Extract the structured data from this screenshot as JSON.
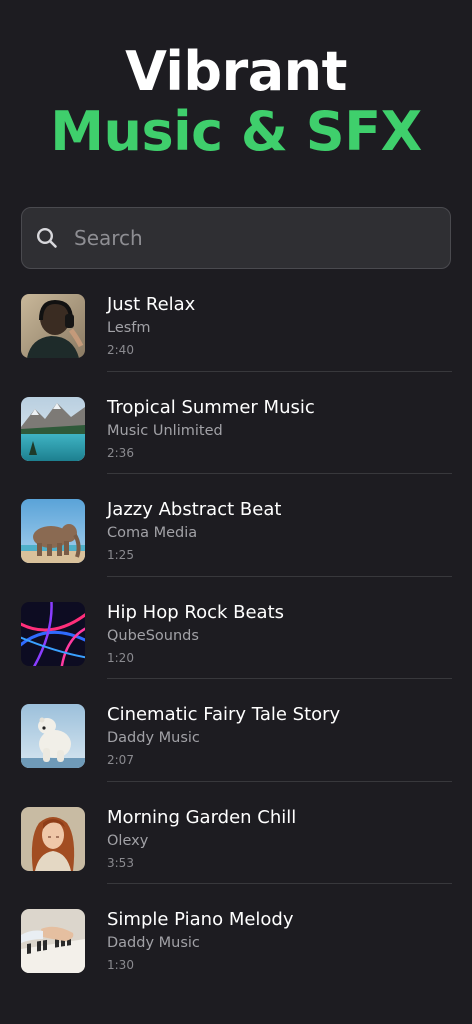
{
  "header": {
    "title_line1": "Vibrant",
    "title_line2": "Music & SFX",
    "accent_color": "#3fcf6c"
  },
  "search": {
    "placeholder": "Search",
    "icon": "search-icon"
  },
  "tracks": [
    {
      "title": "Just Relax",
      "artist": "Lesfm",
      "duration": "2:40",
      "thumbnail": "person-with-headphones"
    },
    {
      "title": "Tropical Summer Music",
      "artist": "Music Unlimited",
      "duration": "2:36",
      "thumbnail": "mountain-lake"
    },
    {
      "title": "Jazzy Abstract Beat",
      "artist": "Coma Media",
      "duration": "1:25",
      "thumbnail": "elephant-on-beach"
    },
    {
      "title": "Hip Hop Rock Beats",
      "artist": "QubeSounds",
      "duration": "1:20",
      "thumbnail": "neon-light-streaks"
    },
    {
      "title": "Cinematic Fairy Tale Story",
      "artist": "Daddy Music",
      "duration": "2:07",
      "thumbnail": "polar-bear"
    },
    {
      "title": "Morning Garden Chill",
      "artist": "Olexy",
      "duration": "3:53",
      "thumbnail": "woman-portrait"
    },
    {
      "title": "Simple Piano Melody",
      "artist": "Daddy Music",
      "duration": "1:30",
      "thumbnail": "piano-keys"
    }
  ]
}
